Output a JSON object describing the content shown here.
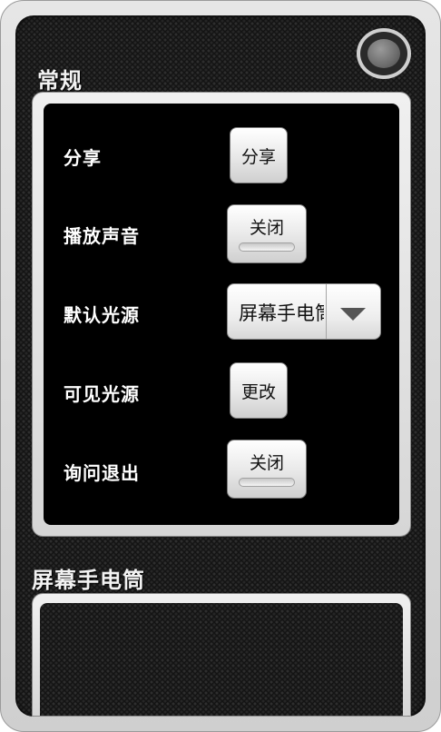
{
  "general_section": {
    "title": "常规",
    "rows": [
      {
        "label": "分享",
        "control": "button",
        "button_label": "分享"
      },
      {
        "label": "播放声音",
        "control": "toggle",
        "button_label": "关闭"
      },
      {
        "label": "默认光源",
        "control": "spinner",
        "selected_value": "屏幕手电筒"
      },
      {
        "label": "可见光源",
        "control": "button",
        "button_label": "更改"
      },
      {
        "label": "询问退出",
        "control": "toggle",
        "button_label": "关闭"
      }
    ]
  },
  "screen_flashlight_section": {
    "title": "屏幕手电筒"
  },
  "icons": {
    "power": "power-ring-icon",
    "dropdown": "triangle-down-icon"
  },
  "colors": {
    "background": "#141414",
    "panel_frame": "#e0e0e0",
    "panel_inner": "#000000",
    "label_text": "#ffffff"
  }
}
